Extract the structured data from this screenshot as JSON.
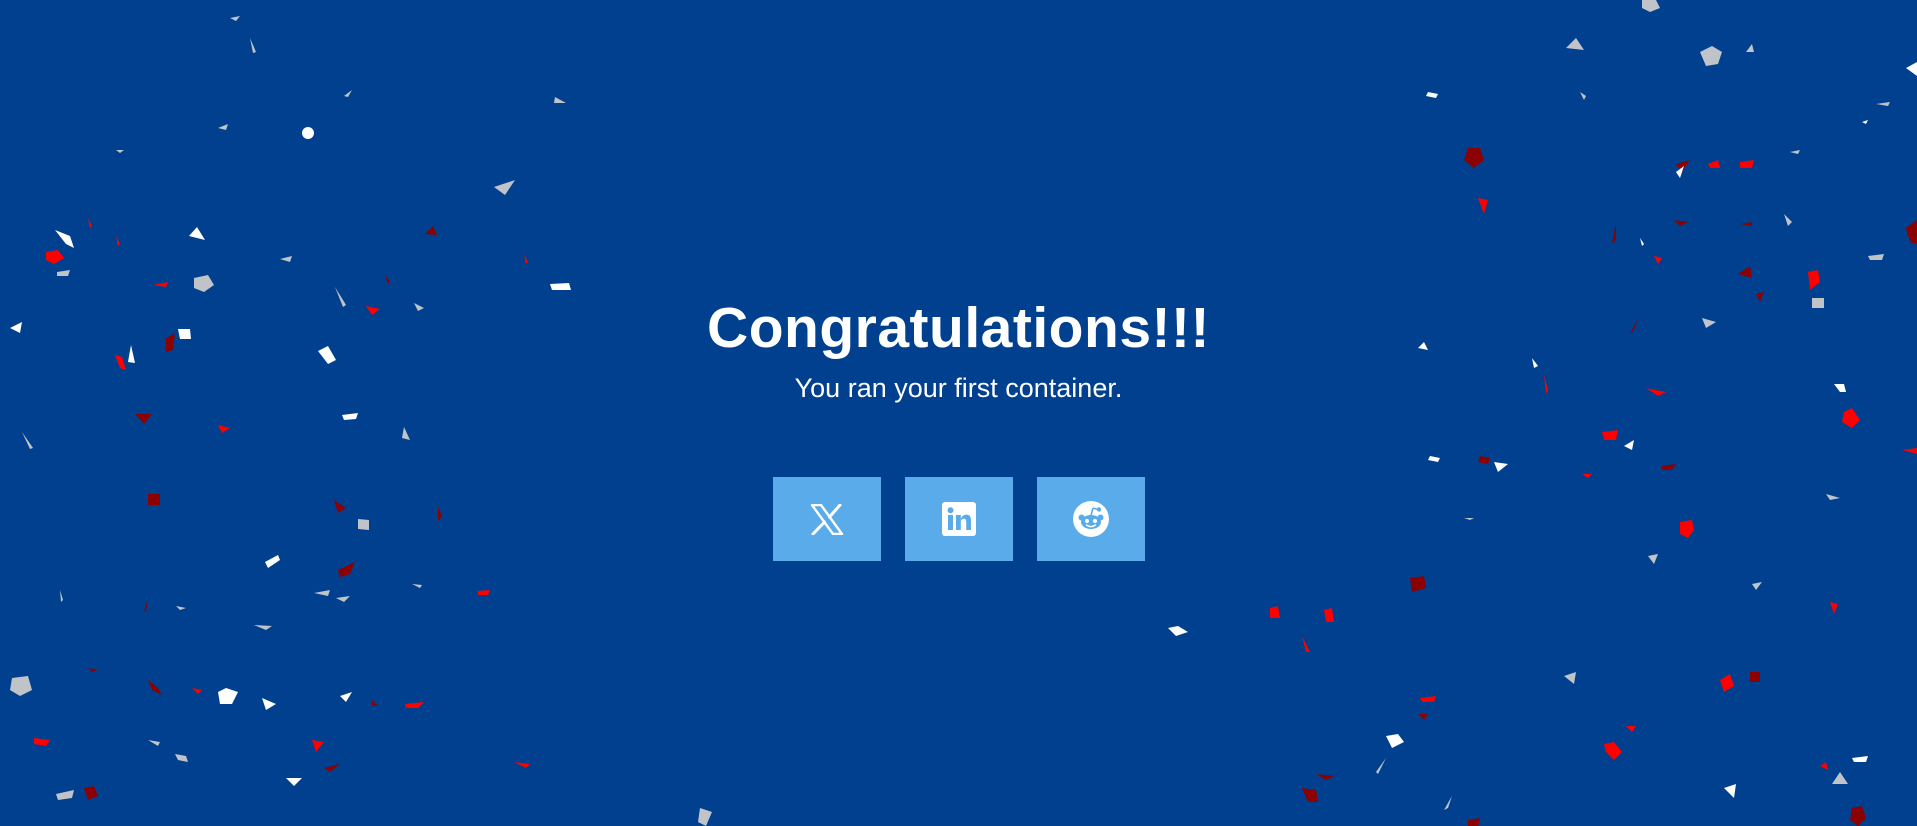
{
  "page": {
    "headline": "Congratulations!!!",
    "subtext": "You ran your first container."
  },
  "share_buttons": [
    {
      "label": "Share on X",
      "icon": "x-logo-icon"
    },
    {
      "label": "Share on LinkedIn",
      "icon": "linkedin-logo-icon"
    },
    {
      "label": "Share on Reddit",
      "icon": "reddit-logo-icon"
    }
  ],
  "colors": {
    "background": "#00408e",
    "button": "#5aabe9",
    "text": "#ffffff",
    "confetti": [
      "#ffffff",
      "#c0c4c8",
      "#ff0000",
      "#8b0000"
    ]
  }
}
